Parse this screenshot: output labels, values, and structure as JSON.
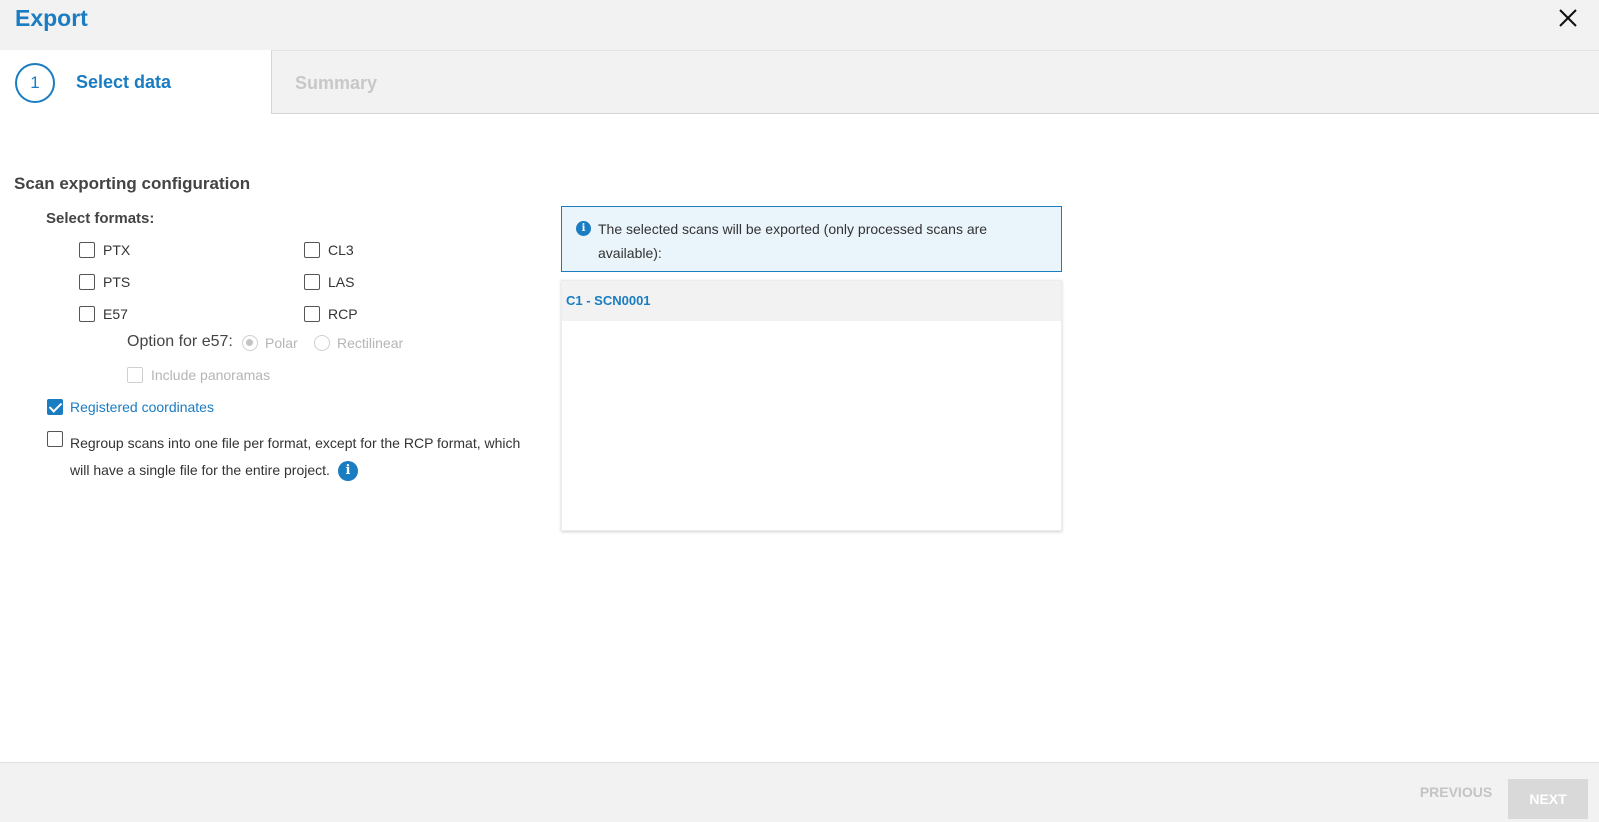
{
  "dialog": {
    "title": "Export"
  },
  "stepper": {
    "steps": [
      {
        "number": "1",
        "label": "Select data",
        "state": "active"
      },
      {
        "label": "Summary",
        "state": "inactive"
      }
    ]
  },
  "config": {
    "section_title": "Scan exporting configuration",
    "formats_title": "Select formats:",
    "formats": [
      {
        "label": "PTX",
        "checked": false
      },
      {
        "label": "CL3",
        "checked": false
      },
      {
        "label": "PTS",
        "checked": false
      },
      {
        "label": "LAS",
        "checked": false
      },
      {
        "label": "E57",
        "checked": false
      },
      {
        "label": "RCP",
        "checked": false
      }
    ],
    "e57_option_label": "Option for e57:",
    "e57_options": [
      {
        "label": "Polar",
        "selected": true
      },
      {
        "label": "Rectilinear",
        "selected": false
      }
    ],
    "include_panoramas": {
      "label": "Include panoramas",
      "checked": false
    },
    "registered_coordinates": {
      "label": "Registered coordinates",
      "checked": true
    },
    "regroup": {
      "label": "Regroup scans into one file per format, except for the RCP format, which will have a single file for the entire project.",
      "checked": false
    }
  },
  "scans_panel": {
    "info_text": "The selected scans will be exported (only processed scans are available):",
    "scans": [
      "C1 - SCN0001"
    ]
  },
  "footer": {
    "previous_label": "PREVIOUS",
    "next_label": "NEXT"
  },
  "colors": {
    "accent": "#1a7cc1",
    "header_bg": "#f2f2f2",
    "disabled": "#c4c4c4"
  }
}
